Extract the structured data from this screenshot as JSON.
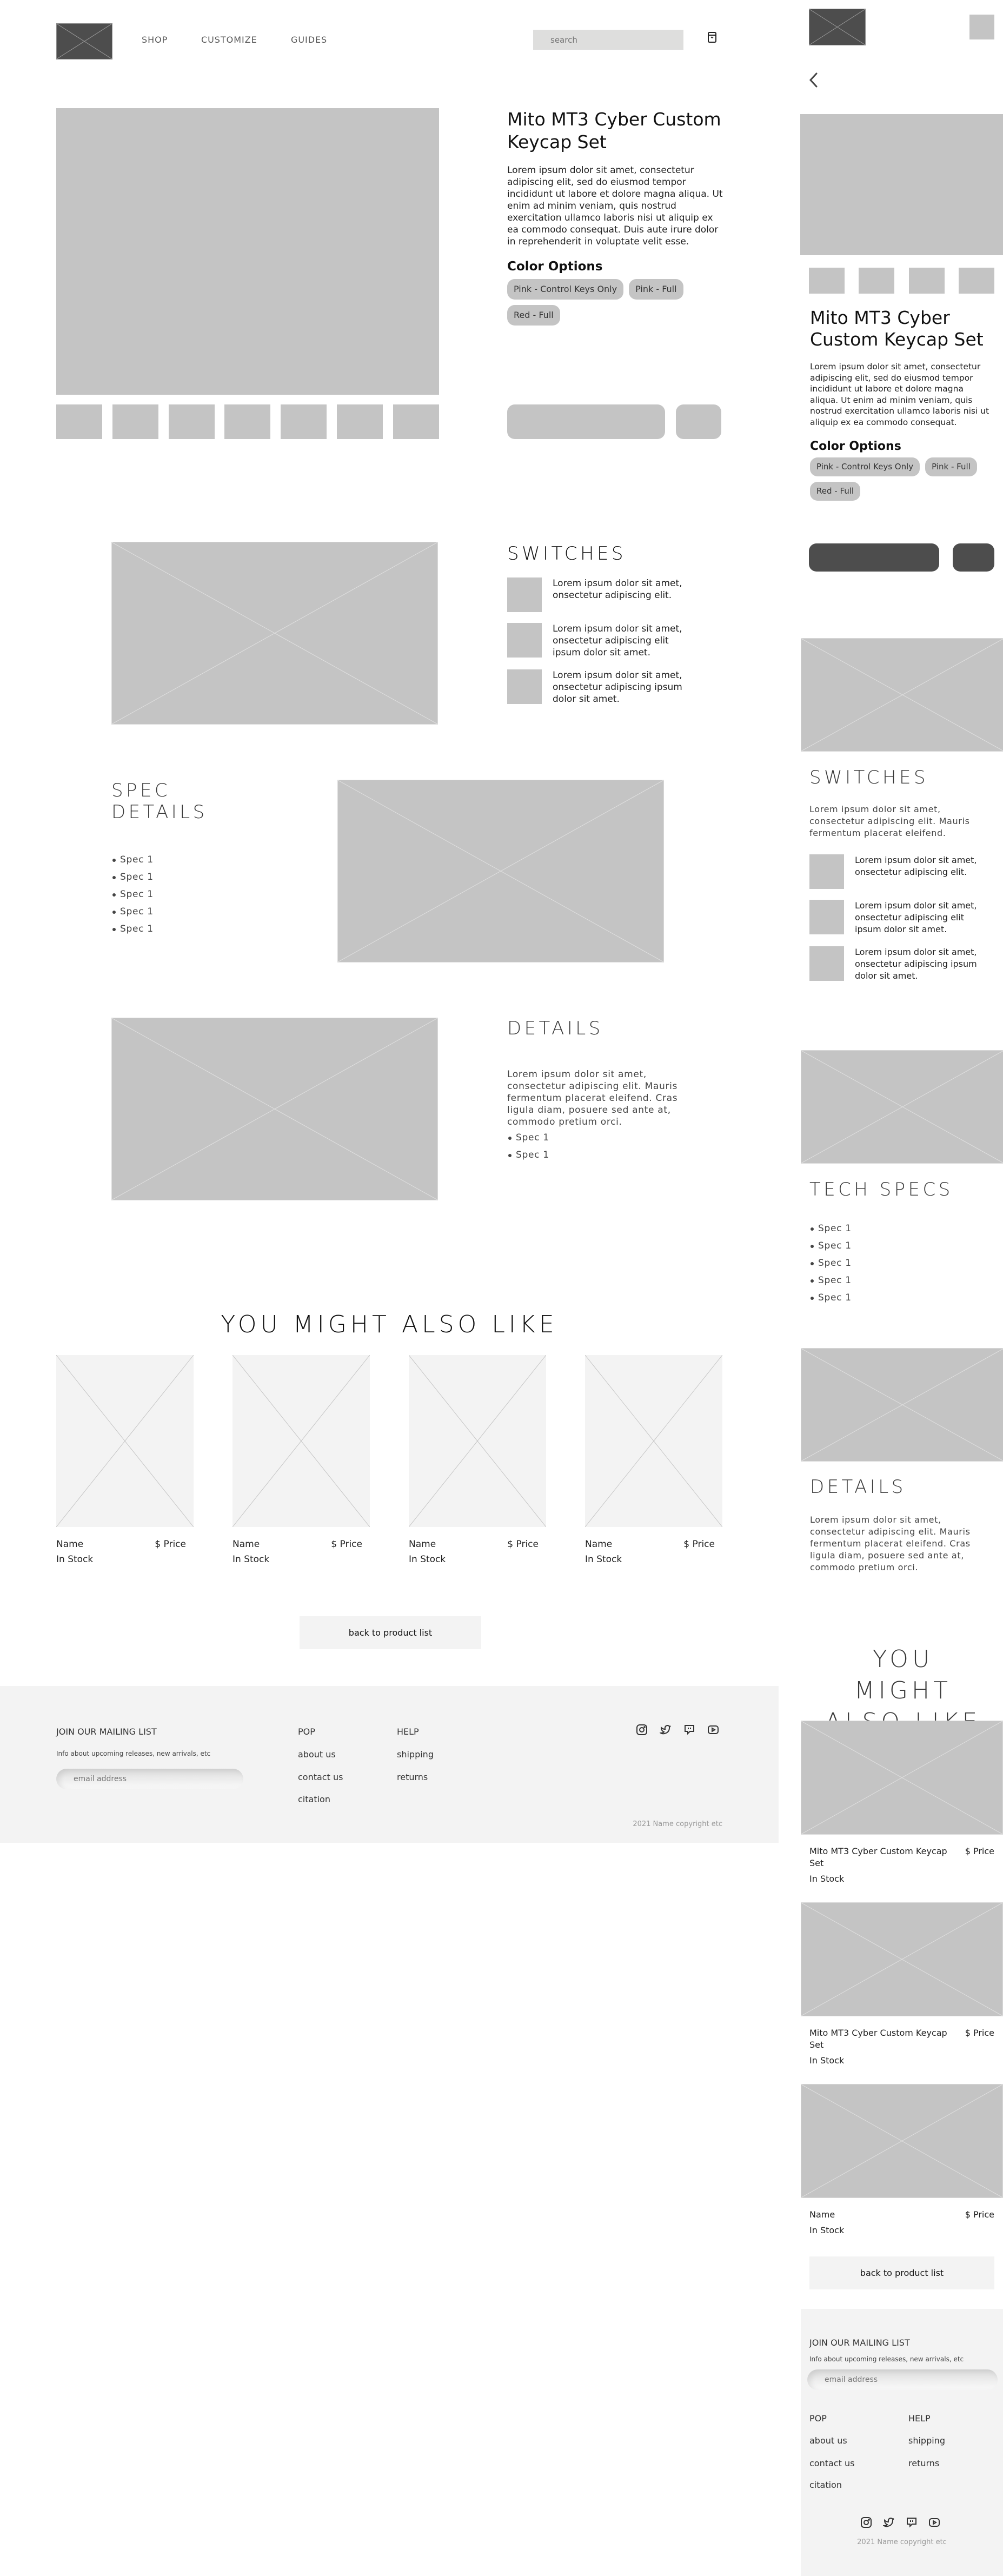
{
  "desktop": {
    "header": {
      "nav": [
        "SHOP",
        "CUSTOMIZE",
        "GUIDES"
      ],
      "search_placeholder": "search",
      "cart_icon": "shopping-bag-icon"
    },
    "product": {
      "title": "Mito MT3 Cyber Custom Keycap Set",
      "description": "Lorem ipsum dolor sit amet, consectetur adipiscing elit, sed do eiusmod tempor incididunt ut labore et dolore magna aliqua. Ut enim ad minim veniam, quis nostrud exercitation ullamco laboris nisi ut aliquip ex ea commodo consequat. Duis aute irure dolor in reprehenderit in voluptate velit esse.",
      "color_options_label": "Color Options",
      "color_options": [
        "Pink - Control Keys Only",
        "Pink - Full",
        "Red - Full"
      ],
      "thumbnail_count": 7
    },
    "switches": {
      "title": "SWITCHES",
      "items": [
        "Lorem ipsum dolor sit amet, onsectetur adipiscing elit.",
        "Lorem ipsum dolor sit amet, onsectetur adipiscing elit ipsum dolor sit amet.",
        "Lorem ipsum dolor sit amet, onsectetur adipiscing ipsum dolor sit amet."
      ]
    },
    "spec_details": {
      "title": "SPEC DETAILS",
      "items": [
        "Spec 1",
        "Spec 1",
        "Spec 1",
        "Spec 1",
        "Spec 1"
      ]
    },
    "details": {
      "title": "DETAILS",
      "text": "Lorem ipsum dolor sit amet, consectetur adipiscing elit. Mauris fermentum placerat eleifend. Cras ligula diam, posuere sed ante at, commodo pretium orci.",
      "items": [
        "Spec 1",
        "Spec 1"
      ]
    },
    "also_like": {
      "title": "YOU MIGHT ALSO LIKE",
      "cards": [
        {
          "name": "Name",
          "price": "$ Price",
          "stock": "In Stock"
        },
        {
          "name": "Name",
          "price": "$ Price",
          "stock": "In Stock"
        },
        {
          "name": "Name",
          "price": "$ Price",
          "stock": "In Stock"
        },
        {
          "name": "Name",
          "price": "$ Price",
          "stock": "In Stock"
        }
      ]
    },
    "back_button": "back to product list",
    "footer": {
      "mailing_title": "JOIN OUR MAILING LIST",
      "mailing_sub": "Info about upcoming releases, new arrivals, etc",
      "email_placeholder": "email address",
      "col1_title": "POP",
      "col1_links": [
        "about us",
        "contact us",
        "citation"
      ],
      "col2_title": "HELP",
      "col2_links": [
        "shipping",
        "returns"
      ],
      "social": [
        "instagram-icon",
        "twitter-icon",
        "twitch-icon",
        "youtube-icon"
      ],
      "copyright": "2021 Name copyright etc"
    }
  },
  "mobile": {
    "product": {
      "title": "Mito MT3 Cyber Custom Keycap Set",
      "description": "Lorem ipsum dolor sit amet, consectetur adipiscing elit, sed do eiusmod tempor incididunt ut labore et dolore magna aliqua. Ut enim ad minim veniam, quis nostrud exercitation ullamco laboris nisi ut aliquip ex ea commodo consequat.",
      "color_options_label": "Color Options",
      "color_options": [
        "Pink - Control Keys Only",
        "Pink - Full",
        "Red - Full"
      ],
      "thumbnail_count": 4
    },
    "switches": {
      "title": "SWITCHES",
      "intro": "Lorem ipsum dolor sit amet, consectetur adipiscing elit. Mauris fermentum placerat eleifend.",
      "items": [
        "Lorem ipsum dolor sit amet, onsectetur adipiscing elit.",
        "Lorem ipsum dolor sit amet, onsectetur adipiscing elit ipsum dolor sit amet.",
        "Lorem ipsum dolor sit amet, onsectetur adipiscing ipsum dolor sit amet."
      ]
    },
    "tech_specs": {
      "title": "TECH SPECS",
      "items": [
        "Spec 1",
        "Spec 1",
        "Spec 1",
        "Spec 1",
        "Spec 1"
      ]
    },
    "details": {
      "title": "DETAILS",
      "text": "Lorem ipsum dolor sit amet, consectetur adipiscing elit. Mauris fermentum placerat eleifend. Cras ligula diam, posuere sed ante at, commodo pretium orci."
    },
    "also_like": {
      "title": "YOU MIGHT ALSO LIKE",
      "cards": [
        {
          "name": "Mito MT3 Cyber Custom Keycap Set",
          "price": "$ Price",
          "stock": "In Stock"
        },
        {
          "name": "Mito MT3 Cyber Custom Keycap Set",
          "price": "$ Price",
          "stock": "In Stock"
        },
        {
          "name": "Name",
          "price": "$ Price",
          "stock": "In Stock"
        }
      ]
    },
    "back_button": "back to product list",
    "footer": {
      "mailing_title": "JOIN OUR MAILING LIST",
      "mailing_sub": "Info about upcoming releases, new arrivals, etc",
      "email_placeholder": "email address",
      "col1_title": "POP",
      "col1_links": [
        "about us",
        "contact us",
        "citation"
      ],
      "col2_title": "HELP",
      "col2_links": [
        "shipping",
        "returns"
      ],
      "copyright": "2021 Name copyright etc"
    }
  },
  "colors": {
    "placeholder": "#c4c4c4",
    "placeholder_light": "#f3f3f3",
    "dark_button": "#4d4d4d",
    "footer_bg": "#f3f3f3",
    "search_bg": "#dededd"
  }
}
